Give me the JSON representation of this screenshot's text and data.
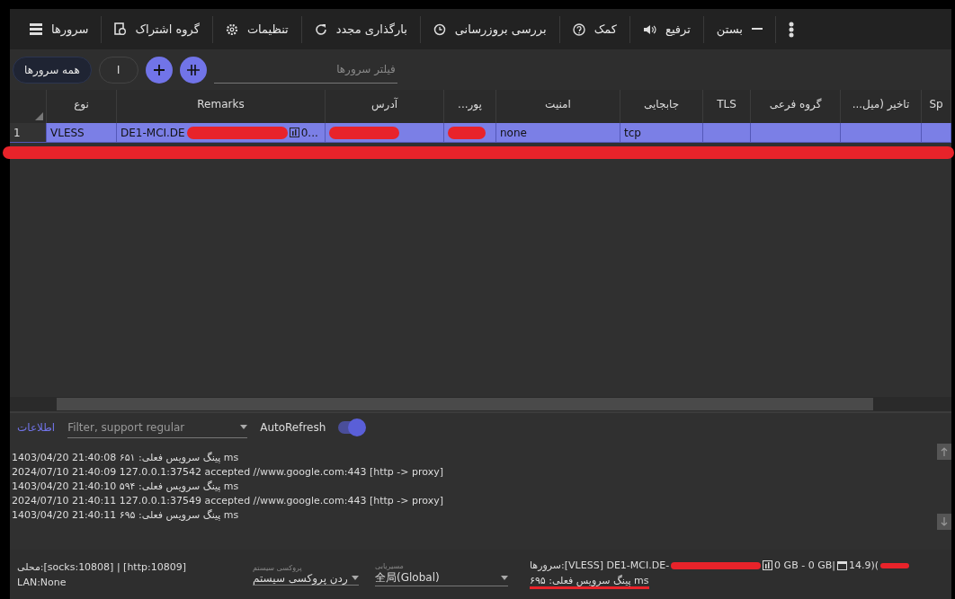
{
  "toolbar": {
    "items": [
      {
        "kind": "more"
      },
      {
        "kind": "close",
        "label": "بستن"
      },
      {
        "kind": "promote",
        "label": "ترفیع"
      },
      {
        "kind": "help",
        "label": "کمک"
      },
      {
        "kind": "update",
        "label": "بررسی بروزرسانی"
      },
      {
        "kind": "reload",
        "label": "بارگذاری مجدد"
      },
      {
        "kind": "settings",
        "label": "تنظیمات"
      },
      {
        "kind": "subscription",
        "label": "گروه اشتراک"
      },
      {
        "kind": "servers",
        "label": "سرورها"
      }
    ]
  },
  "filter_bar": {
    "group_tabs": [
      {
        "label": "ا",
        "selected": false
      },
      {
        "label": "همه سرورها",
        "selected": true
      }
    ],
    "search": {
      "placeholder": "فیلتر سرورها"
    }
  },
  "table": {
    "columns": [
      "Sp",
      "...تاخیر (میل",
      "گروه فرعی",
      "TLS",
      "جابجایی",
      "امنیت",
      "...پور",
      "آدرس",
      "Remarks",
      "نوع"
    ],
    "rows": [
      {
        "index": "1",
        "selected": true,
        "cells": [
          "",
          "",
          "",
          "",
          "tcp",
          "none",
          "",
          "",
          "DE1-MCI.DE",
          "VLESS"
        ],
        "remarks_tail": "0..."
      }
    ]
  },
  "log": {
    "tab": "اطلاعات",
    "filter": {
      "placeholder": "Filter, support regular"
    },
    "auto_refresh": {
      "label": "AutoRefresh",
      "on": true
    },
    "lines": [
      "1403/04/20 21:40:08 پینگ سرویس فعلی: ۶۵۱ ms",
      "2024/07/10 21:40:09 127.0.0.1:37542 accepted //www.google.com:443 [http -> proxy]",
      "1403/04/20 21:40:10 پینگ سرویس فعلی: ۵۹۴ ms",
      "2024/07/10 21:40:11 127.0.0.1:37549 accepted //www.google.com:443 [http -> proxy]",
      "1403/04/20 21:40:11 پینگ سرویس فعلی: ۶۹۵ ms"
    ]
  },
  "status_bar": {
    "local": "محلی:[socks:10808] | [http:10809]",
    "lan": "LAN:None",
    "system_proxy": {
      "label": "پروکسی سیستم",
      "value": "ردن پروکسی سیستم"
    },
    "routing": {
      "label": "مسیریابی",
      "value": "全局(Global)"
    },
    "server": "سرورها:[VLESS] DE1-MCI.DE-",
    "traffic": "0 GB - 0 GB|",
    "expiry": "14.9)(",
    "ping": "پینگ سرویس فعلی: ۶۹۵ ms"
  }
}
